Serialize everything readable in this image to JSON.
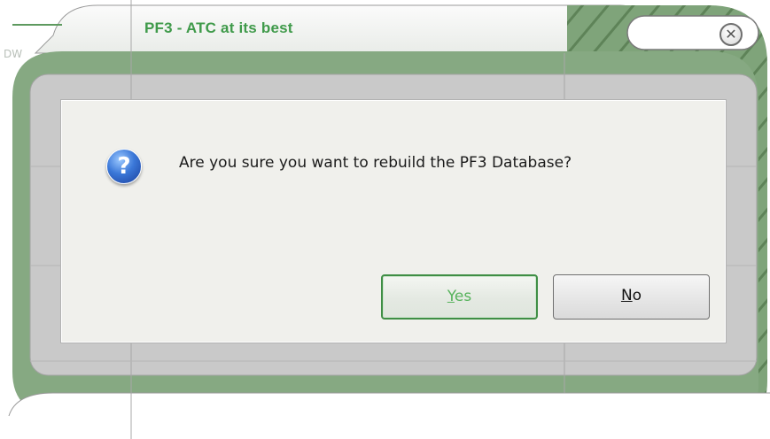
{
  "window": {
    "title": "PF3 - ATC at its best",
    "background_text": "DW",
    "close_glyph": "✕",
    "close_icon": "close-icon"
  },
  "dialog": {
    "icon": "question-icon",
    "icon_glyph": "?",
    "message": "Are you sure you want to rebuild the PF3 Database?",
    "yes_mnemonic": "Y",
    "yes_rest": "es",
    "no_mnemonic": "N",
    "no_rest": "o"
  },
  "colors": {
    "frame_green": "#7fa47a",
    "title_green": "#3f9a4a",
    "dialog_bg": "#f0f0ec",
    "default_button_border": "#3f8e45"
  }
}
